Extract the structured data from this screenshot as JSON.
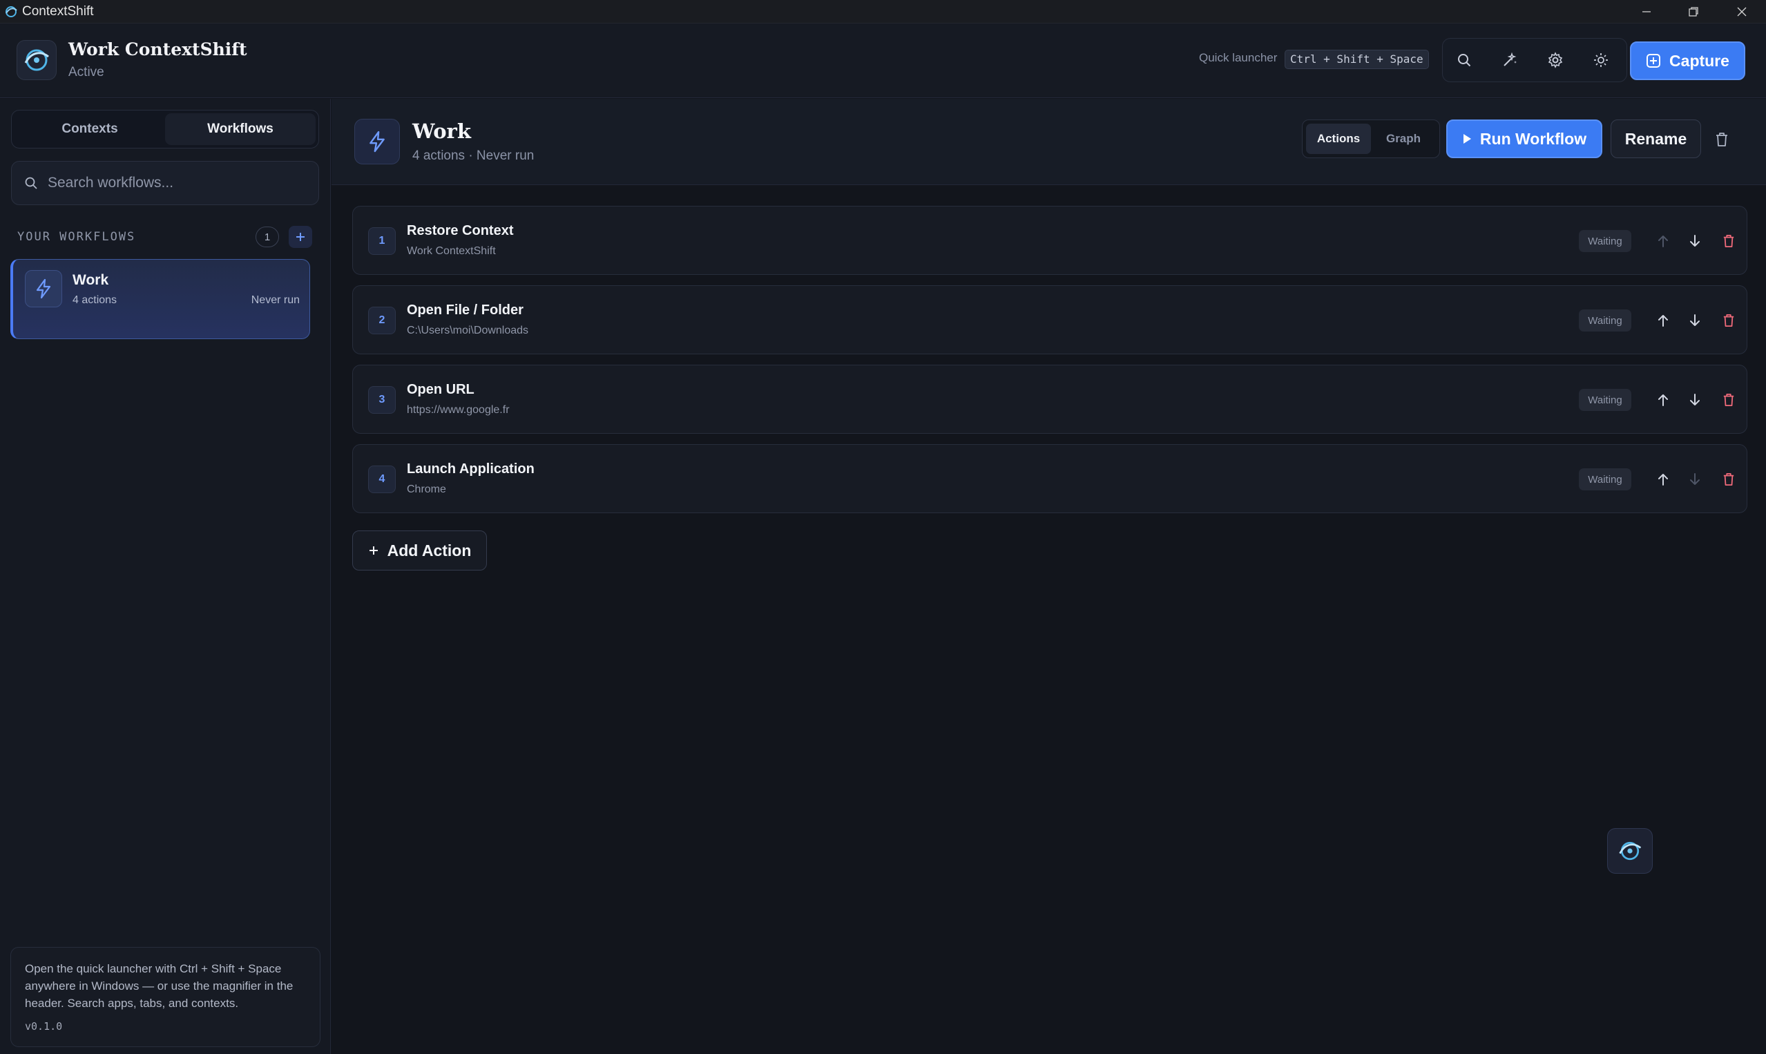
{
  "window": {
    "title": "ContextShift"
  },
  "header": {
    "title": "Work ContextShift",
    "status": "Active",
    "quick_launcher_label": "Quick launcher",
    "quick_launcher_shortcut": "Ctrl + Shift + Space",
    "tools": [
      "search-icon",
      "wand-icon",
      "gear-icon",
      "sun-icon"
    ],
    "capture_label": "Capture"
  },
  "sidebar": {
    "tabs": [
      {
        "label": "Contexts",
        "active": false
      },
      {
        "label": "Workflows",
        "active": true
      }
    ],
    "search_placeholder": "Search workflows...",
    "section_title": "YOUR WORKFLOWS",
    "count": "1",
    "workflows": [
      {
        "name": "Work",
        "subtitle": "4 actions",
        "last_run": "Never run",
        "selected": true
      }
    ],
    "help_text": "Open the quick launcher with Ctrl + Shift + Space anywhere in Windows — or use the magnifier in the header. Search apps, tabs, and contexts.",
    "version": "v0.1.0"
  },
  "main": {
    "title": "Work",
    "subtitle": "4 actions · Never run",
    "view_tabs": [
      {
        "label": "Actions",
        "active": true
      },
      {
        "label": "Graph",
        "active": false
      }
    ],
    "run_label": "Run Workflow",
    "rename_label": "Rename",
    "actions": [
      {
        "num": "1",
        "title": "Restore Context",
        "detail": "Work ContextShift",
        "status": "Waiting",
        "up_enabled": false,
        "down_enabled": true
      },
      {
        "num": "2",
        "title": "Open File / Folder",
        "detail": "C:\\Users\\moi\\Downloads",
        "status": "Waiting",
        "up_enabled": true,
        "down_enabled": true
      },
      {
        "num": "3",
        "title": "Open URL",
        "detail": "https://www.google.fr",
        "status": "Waiting",
        "up_enabled": true,
        "down_enabled": true
      },
      {
        "num": "4",
        "title": "Launch Application",
        "detail": "Chrome",
        "status": "Waiting",
        "up_enabled": true,
        "down_enabled": false
      }
    ],
    "add_action_label": "Add Action"
  },
  "colors": {
    "accent": "#3b7bf3",
    "background": "#12151c",
    "danger": "#f06a7a"
  }
}
